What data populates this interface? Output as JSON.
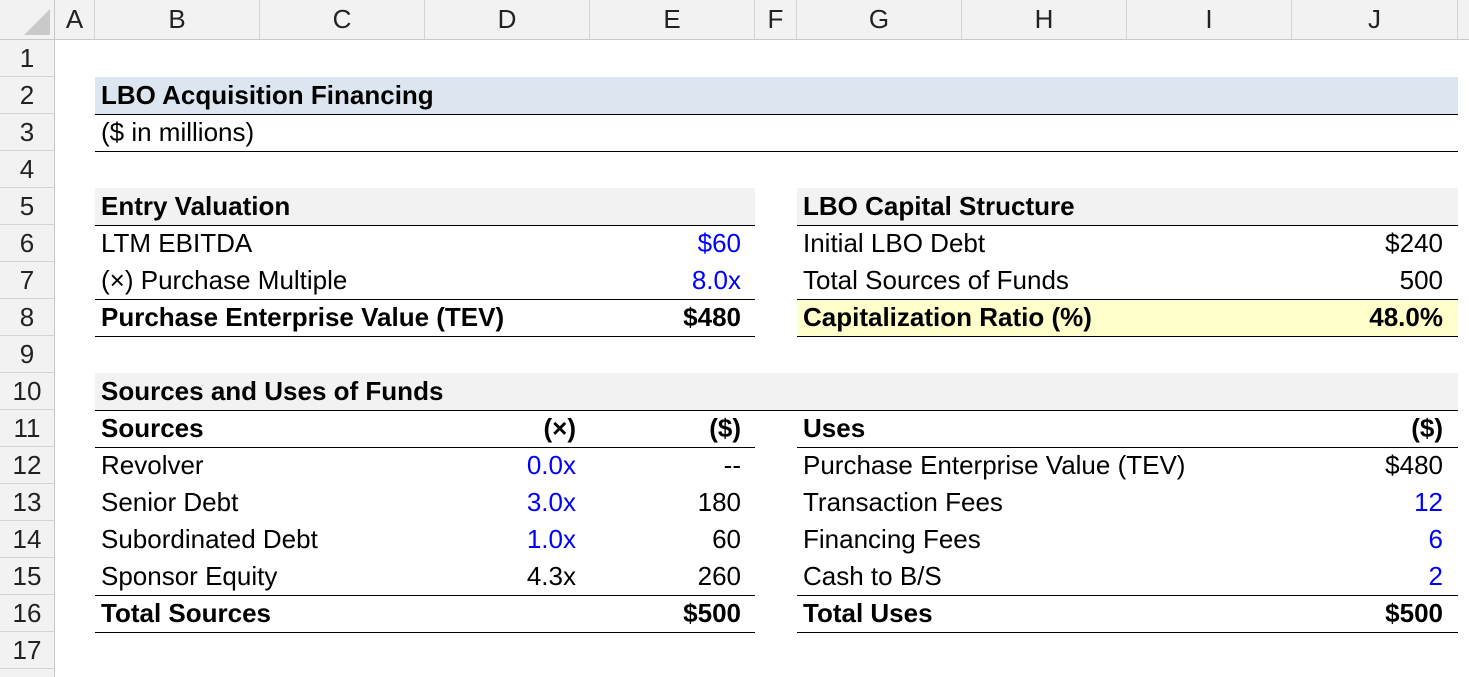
{
  "grid": {
    "columns": [
      "A",
      "B",
      "C",
      "D",
      "E",
      "F",
      "G",
      "H",
      "I",
      "J"
    ],
    "rows": [
      "1",
      "2",
      "3",
      "4",
      "5",
      "6",
      "7",
      "8",
      "9",
      "10",
      "11",
      "12",
      "13",
      "14",
      "15",
      "16",
      "17"
    ]
  },
  "title": "LBO Acquisition Financing",
  "subtitle": "($ in millions)",
  "entry": {
    "header": "Entry Valuation",
    "ltm_label": "LTM EBITDA",
    "ltm_value": "$60",
    "multiple_label": "(×) Purchase Multiple",
    "multiple_value": "8.0x",
    "tev_label": "Purchase Enterprise Value (TEV)",
    "tev_value": "$480"
  },
  "capital": {
    "header": "LBO Capital Structure",
    "debt_label": "Initial LBO Debt",
    "debt_value": "$240",
    "sources_label": "Total Sources of Funds",
    "sources_value": "500",
    "ratio_label": "Capitalization Ratio (%)",
    "ratio_value": "48.0%"
  },
  "su": {
    "header": "Sources and Uses of Funds",
    "sources_header": "Sources",
    "mult_header": "(×)",
    "dollar_header": "($)",
    "uses_header": "Uses",
    "uses_dollar_header": "($)",
    "sources": [
      {
        "label": "Revolver",
        "mult": "0.0x",
        "amount": "--"
      },
      {
        "label": "Senior Debt",
        "mult": "3.0x",
        "amount": "180"
      },
      {
        "label": "Subordinated Debt",
        "mult": "1.0x",
        "amount": "60"
      },
      {
        "label": "Sponsor Equity",
        "mult": "4.3x",
        "amount": "260"
      }
    ],
    "total_sources_label": "Total Sources",
    "total_sources_value": "$500",
    "uses": [
      {
        "label": "Purchase Enterprise Value (TEV)",
        "amount": "$480"
      },
      {
        "label": "Transaction Fees",
        "amount": "12"
      },
      {
        "label": "Financing Fees",
        "amount": "6"
      },
      {
        "label": "Cash to B/S",
        "amount": "2"
      }
    ],
    "total_uses_label": "Total Uses",
    "total_uses_value": "$500"
  },
  "colors": {
    "title_band": "#dce6f1",
    "section_band": "#f2f2f2",
    "highlight_band": "#ffffcc",
    "input_blue": "#0000ff"
  }
}
